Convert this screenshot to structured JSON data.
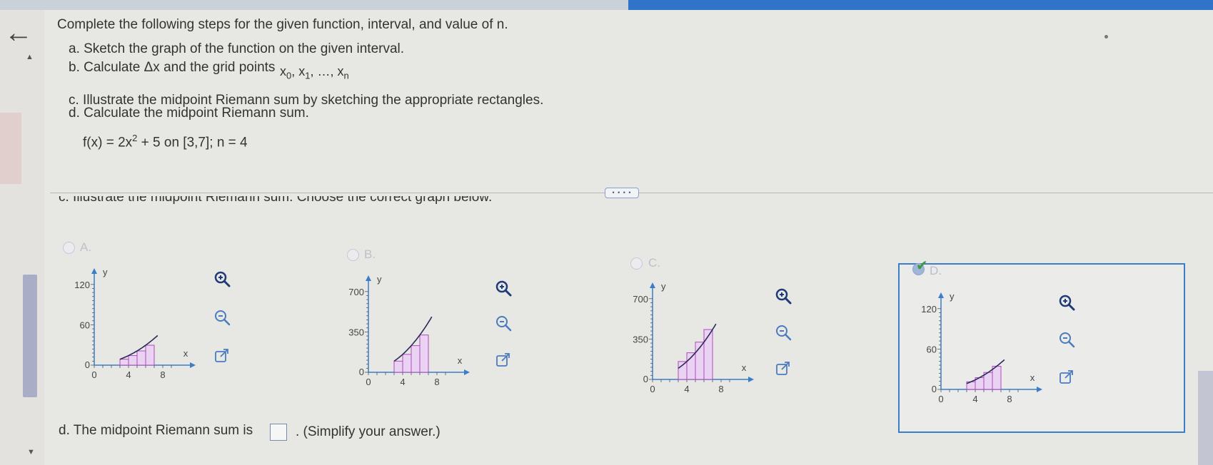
{
  "question": {
    "title": "Complete the following steps for the given function, interval, and value of n.",
    "step_a": "a. Sketch the graph of the function on the given interval.",
    "step_b": "b. Calculate Δx and the grid points",
    "step_b_x0": "x",
    "step_b_x0_sub": "0",
    "step_b_x1": "x",
    "step_b_x1_sub": "1",
    "step_b_dots": "…,",
    "step_b_xn": "x",
    "step_b_xn_sub": "n",
    "step_c": "c. Illustrate the midpoint Riemann sum by sketching the appropriate rectangles.",
    "step_d": "d. Calculate the midpoint Riemann sum.",
    "function_lhs": "f(x) = 2x",
    "function_exp": "2",
    "function_rhs": " + 5 on [3,7]; n = 4"
  },
  "more_button": "• • • •",
  "part_c": {
    "instruction": "c. Illustrate the midpoint Riemann sum. Choose the correct graph below.",
    "options": [
      {
        "letter": "A.",
        "selected": false,
        "ymax_label": "120",
        "ymid_label": "60",
        "y0_label": "0",
        "x0_label": "0",
        "x4_label": "4",
        "x8_label": "8",
        "x_axis": "x",
        "y_axis": "y"
      },
      {
        "letter": "B.",
        "selected": false,
        "ymax_label": "700",
        "ymid_label": "350",
        "y0_label": "0",
        "x0_label": "0",
        "x4_label": "4",
        "x8_label": "8",
        "x_axis": "x",
        "y_axis": "y"
      },
      {
        "letter": "C.",
        "selected": false,
        "ymax_label": "700",
        "ymid_label": "350",
        "y0_label": "0",
        "x0_label": "0",
        "x4_label": "4",
        "x8_label": "8",
        "x_axis": "x",
        "y_axis": "y"
      },
      {
        "letter": "D.",
        "selected": true,
        "ymax_label": "120",
        "ymid_label": "60",
        "y0_label": "0",
        "x0_label": "0",
        "x4_label": "4",
        "x8_label": "8",
        "x_axis": "x",
        "y_axis": "y"
      }
    ],
    "icons": [
      "zoom-in-icon",
      "zoom-out-icon",
      "popout-icon"
    ]
  },
  "part_d": {
    "label": "d. The midpoint Riemann sum is",
    "answer_value": "",
    "hint": ". (Simplify your answer.)"
  },
  "colors": {
    "rect_fill": "#ead2f2",
    "rect_stroke": "#b04bbf",
    "curve": "#2a2a5a",
    "accent": "#3b7dc9"
  }
}
